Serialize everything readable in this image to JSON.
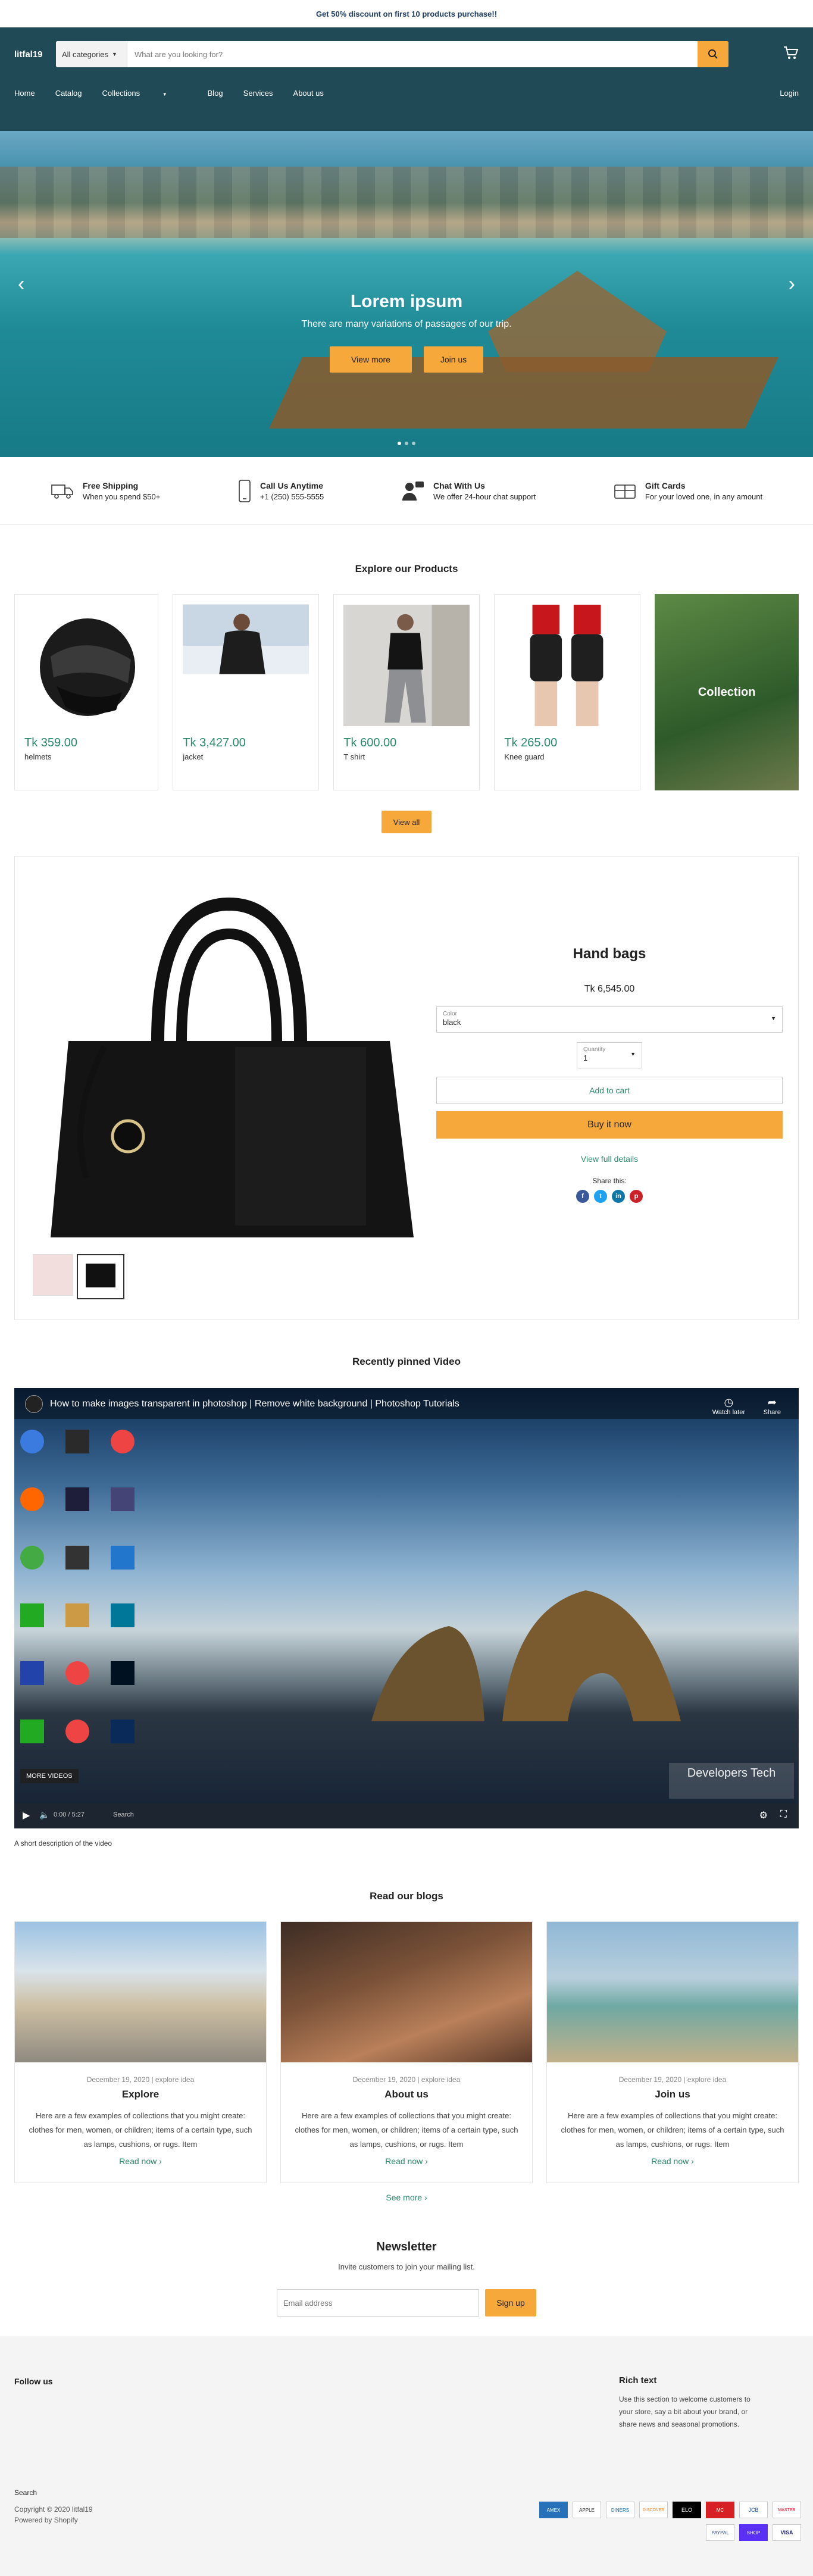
{
  "announcement": "Get 50% discount on first 10 products purchase!!",
  "header": {
    "logo": "litfal19",
    "category": "All categories",
    "search_placeholder": "What are you looking for?",
    "nav": [
      "Home",
      "Catalog",
      "Collections",
      "Blog",
      "Services",
      "About us"
    ],
    "login": "Login"
  },
  "hero": {
    "title": "Lorem ipsum",
    "subtitle": "There are many variations of passages of our trip.",
    "btn1": "View more",
    "btn2": "Join us"
  },
  "features": [
    {
      "title": "Free Shipping",
      "sub": "When you spend $50+"
    },
    {
      "title": "Call Us Anytime",
      "sub": "+1 (250) 555-5555"
    },
    {
      "title": "Chat With Us",
      "sub": "We offer 24-hour chat support"
    },
    {
      "title": "Gift Cards",
      "sub": "For your loved one, in any amount"
    }
  ],
  "products": {
    "title": "Explore our Products",
    "items": [
      {
        "price": "Tk 359.00",
        "name": "helmets"
      },
      {
        "price": "Tk 3,427.00",
        "name": "jacket"
      },
      {
        "price": "Tk 600.00",
        "name": "T shirt"
      },
      {
        "price": "Tk 265.00",
        "name": "Knee guard"
      }
    ],
    "collection_label": "Collection",
    "view_all": "View all"
  },
  "featured": {
    "title": "Hand bags",
    "price": "Tk 6,545.00",
    "color_label": "Color",
    "color_value": "black",
    "qty_label": "Quantity",
    "qty_value": "1",
    "add_to_cart": "Add to cart",
    "buy_now": "Buy it now",
    "view_details": "View full details",
    "share": "Share this:"
  },
  "video": {
    "section_title": "Recently pinned Video",
    "title": "How to make images transparent in photoshop | Remove white background | Photoshop Tutorials",
    "watch_later": "Watch later",
    "share": "Share",
    "more_videos": "MORE VIDEOS",
    "watermark": "Developers Tech",
    "time": "0:00 / 5:27",
    "search": "Search",
    "caption": "A short description of the video"
  },
  "blogs": {
    "title": "Read our blogs",
    "meta": "December 19, 2020  |  explore idea",
    "items": [
      {
        "title": "Explore",
        "text": "Here are a few examples of collections that you might create: clothes for men, women, or children; items of a certain type, such as lamps, cushions, or rugs. Item"
      },
      {
        "title": "About us",
        "text": "Here are a few examples of collections that you might create: clothes for men, women, or children; items of a certain type, such as lamps, cushions, or rugs. Item"
      },
      {
        "title": "Join us",
        "text": "Here are a few examples of collections that you might create: clothes for men, women, or children; items of a certain type, such as lamps, cushions, or rugs. Item"
      }
    ],
    "read_now": "Read now",
    "see_more": "See more"
  },
  "newsletter": {
    "title": "Newsletter",
    "sub": "Invite customers to join your mailing list.",
    "placeholder": "Email address",
    "btn": "Sign up"
  },
  "footer": {
    "follow": "Follow us",
    "rich_title": "Rich text",
    "rich_text": "Use this section to welcome customers to your store, say a bit about your brand, or share news and seasonal promotions.",
    "search": "Search",
    "copyright": "Copyright © 2020 litfal19",
    "powered": "Powered by Shopify",
    "payments": [
      "AMEX",
      "APPLE",
      "DINERS",
      "DISCOVER",
      "ELO",
      "MC",
      "JCB",
      "MASTER",
      "PAYPAL",
      "SHOP",
      "VISA"
    ]
  },
  "colors": {
    "accent": "#f7a83a",
    "header": "#204a55",
    "price": "#2b8a6b"
  }
}
